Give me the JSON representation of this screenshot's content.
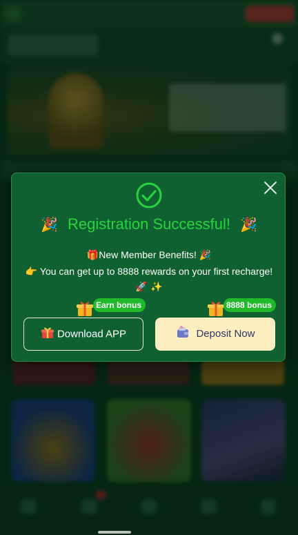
{
  "modal": {
    "title": "Registration Successful!",
    "party_emoji": "🎉",
    "benefits_line": "New Member Benefits!",
    "benefits_prefix_emoji": "🎁",
    "benefits_suffix_emoji": "🎉",
    "rewards_line": "You can get up to 8888 rewards on your first recharge!",
    "rewards_prefix_emoji": "👉",
    "rocket_line": "🚀 ✨",
    "earn_bonus_tag": "Earn bonus",
    "deposit_bonus_tag": "8888 bonus",
    "download_label": "Download APP",
    "deposit_label": "Deposit Now"
  },
  "colors": {
    "modal_bg": "#0f6131",
    "title_green": "#27d43e",
    "bonus_tag_green": "#1fb92a",
    "deposit_button_bg": "#fdeec2",
    "deposit_text": "#2f3760"
  },
  "icons": [
    "success-check-icon",
    "close-icon",
    "gift-icon",
    "gift-box-icon",
    "wallet-icon",
    "party-popper-icon"
  ]
}
